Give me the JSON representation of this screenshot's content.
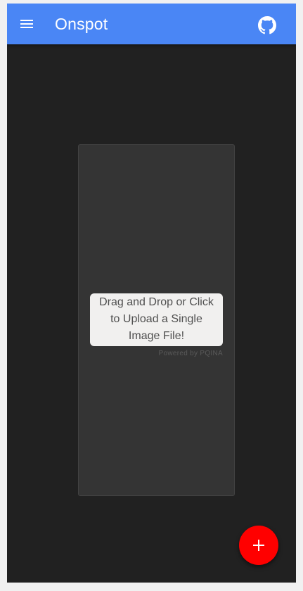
{
  "app_bar": {
    "title": "Onspot",
    "background_color": "#4a86f5",
    "menu_icon": "hamburger-menu-icon",
    "github_icon": "github-icon"
  },
  "upload": {
    "prompt": "Drag and Drop or Click to Upload a Single Image File!",
    "credits": "Powered by PQINA"
  },
  "fab": {
    "icon": "plus-icon",
    "color": "#ff0000"
  },
  "theme": {
    "page_background": "#212121",
    "dropzone_background": "#343434"
  }
}
